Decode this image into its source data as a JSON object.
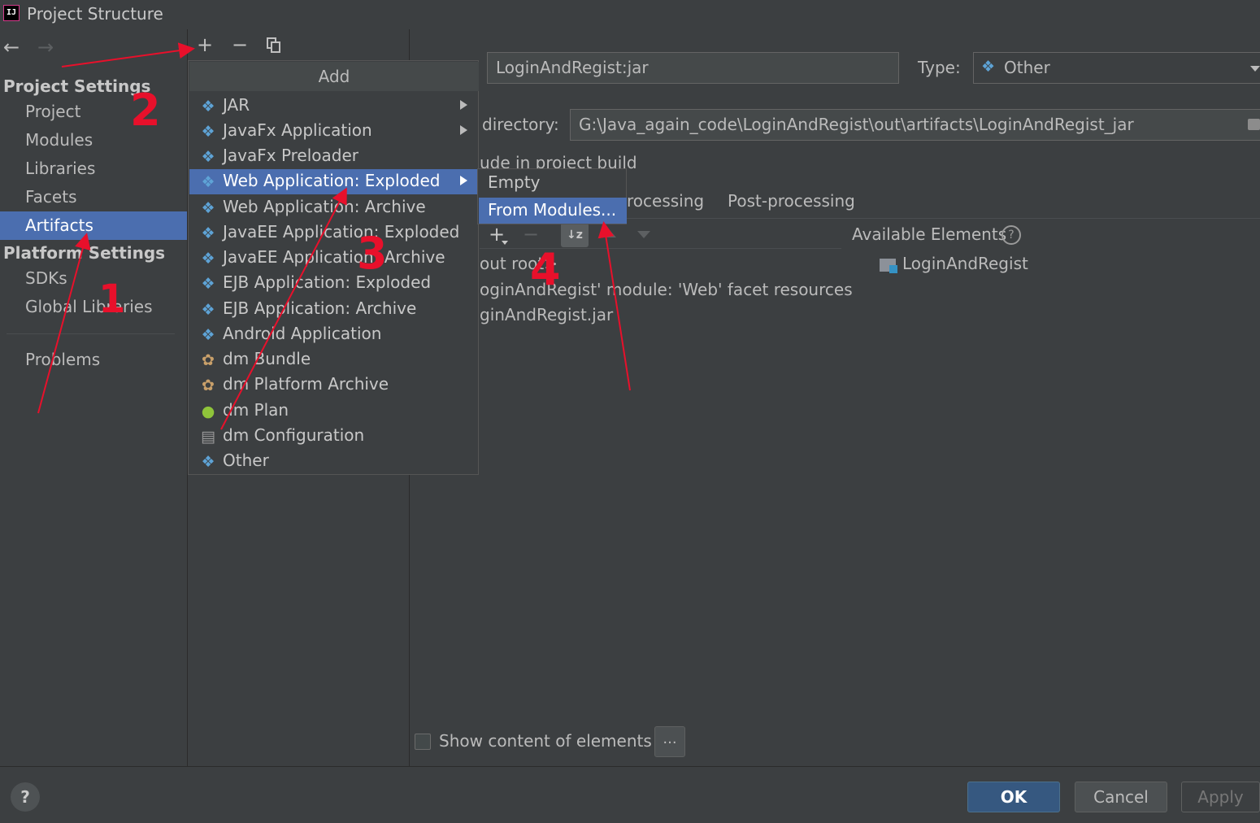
{
  "window": {
    "title": "Project Structure",
    "app_icon": "intellij-idea-icon"
  },
  "nav": {
    "back_icon": "arrow-left-icon",
    "forward_icon": "arrow-right-icon"
  },
  "sidebar": {
    "project_settings_label": "Project Settings",
    "project_settings_items": [
      "Project",
      "Modules",
      "Libraries",
      "Facets",
      "Artifacts"
    ],
    "platform_settings_label": "Platform Settings",
    "platform_settings_items": [
      "SDKs",
      "Global Libraries"
    ],
    "problems_label": "Problems",
    "selected": "Artifacts"
  },
  "toolbar": {
    "add_icon": "plus-icon",
    "remove_icon": "minus-icon",
    "copy_icon": "copy-icon"
  },
  "add_menu": {
    "header": "Add",
    "items": [
      {
        "label": "JAR",
        "icon": "artifact-diamond-icon",
        "has_submenu": true
      },
      {
        "label": "JavaFx Application",
        "icon": "artifact-diamond-icon",
        "has_submenu": true
      },
      {
        "label": "JavaFx Preloader",
        "icon": "artifact-diamond-icon",
        "has_submenu": false
      },
      {
        "label": "Web Application: Exploded",
        "icon": "web-artifact-icon",
        "has_submenu": true
      },
      {
        "label": "Web Application: Archive",
        "icon": "web-artifact-icon",
        "has_submenu": false
      },
      {
        "label": "JavaEE Application: Exploded",
        "icon": "javaee-artifact-icon",
        "has_submenu": false
      },
      {
        "label": "JavaEE Application: Archive",
        "icon": "javaee-artifact-icon",
        "has_submenu": false
      },
      {
        "label": "EJB Application: Exploded",
        "icon": "artifact-diamond-icon",
        "has_submenu": false
      },
      {
        "label": "EJB Application: Archive",
        "icon": "artifact-diamond-icon",
        "has_submenu": false
      },
      {
        "label": "Android Application",
        "icon": "artifact-diamond-icon",
        "has_submenu": false
      },
      {
        "label": "dm Bundle",
        "icon": "bundle-icon",
        "has_submenu": false
      },
      {
        "label": "dm Platform Archive",
        "icon": "bundle-archive-icon",
        "has_submenu": false
      },
      {
        "label": "dm Plan",
        "icon": "plan-icon",
        "has_submenu": false
      },
      {
        "label": "dm Configuration",
        "icon": "config-file-icon",
        "has_submenu": false
      },
      {
        "label": "Other",
        "icon": "artifact-diamond-icon",
        "has_submenu": false
      }
    ],
    "selected": "Web Application: Exploded"
  },
  "submenu": {
    "items": [
      "Empty",
      "From Modules..."
    ],
    "selected": "From Modules..."
  },
  "artifact": {
    "name": "LoginAndRegist:jar",
    "type_label": "Type:",
    "type_value": "Other",
    "output_dir_label": "directory:",
    "output_dir_value": "G:\\Java_again_code\\LoginAndRegist\\out\\artifacts\\LoginAndRegist_jar",
    "include_build_label": "ude in project build"
  },
  "tabs": [
    "rocessing",
    "Post-processing"
  ],
  "layout_toolbar": {
    "add_icon": "plus-icon",
    "remove_icon": "minus-icon",
    "sort_icon": "sort-icon",
    "up_icon": "arrow-up-icon",
    "down_icon": "arrow-down-icon"
  },
  "output_tree": [
    "out root>",
    "oginAndRegist' module: 'Web' facet resources",
    "ginAndRegist.jar"
  ],
  "available_elements": {
    "label": "Available Elements",
    "help_icon": "help-circle-icon",
    "items": [
      "LoginAndRegist"
    ]
  },
  "show_content": {
    "label": "Show content of elements",
    "checked": false,
    "ellipsis": "..."
  },
  "buttons": {
    "help": "?",
    "ok": "OK",
    "cancel": "Cancel",
    "apply": "Apply"
  },
  "annotations": {
    "step1": "1",
    "step2": "2",
    "step3": "3",
    "step4": "4",
    "color": "#e8102b"
  }
}
